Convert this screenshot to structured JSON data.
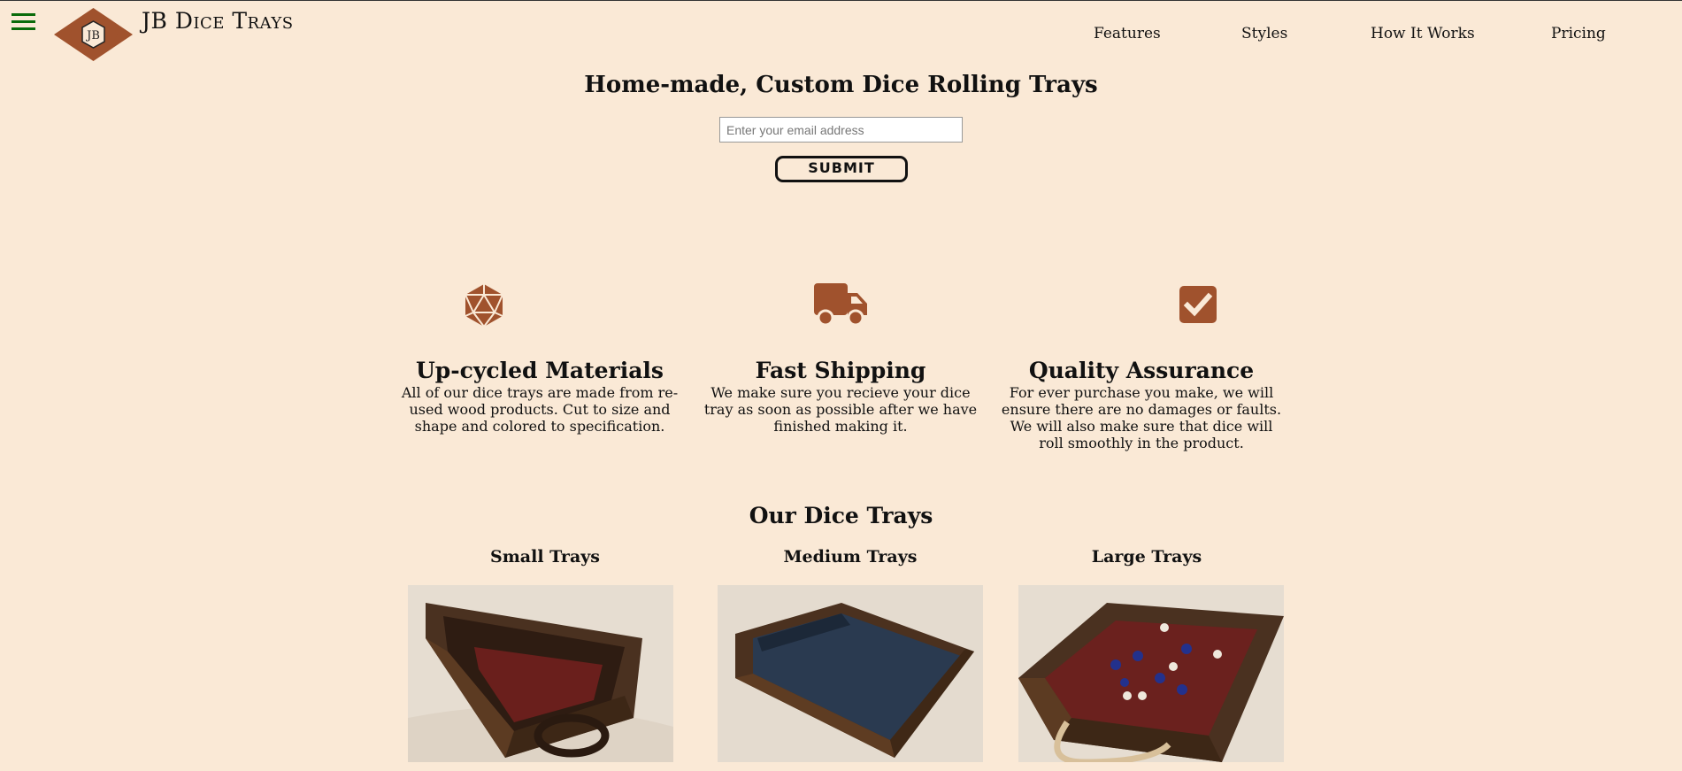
{
  "header": {
    "brand": "JB Dice Trays",
    "logo_letters": "JB",
    "nav": [
      "Features",
      "Styles",
      "How It Works",
      "Pricing"
    ]
  },
  "hero": {
    "title": "Home-made, Custom Dice Rolling Trays",
    "email_placeholder": "Enter your email address",
    "submit_label": "SUBMIT"
  },
  "features": [
    {
      "icon": "d20-dice-icon",
      "title": "Up-cycled Materials",
      "text": "All of our dice trays are made from re-used wood products. Cut to size and shape and colored to specification."
    },
    {
      "icon": "truck-icon",
      "title": "Fast Shipping",
      "text": "We make sure you recieve your dice tray as soon as possible after we have finished making it."
    },
    {
      "icon": "checkbox-icon",
      "title": "Quality Assurance",
      "text": "For ever purchase you make, we will ensure there are no damages or faults. We will also make sure that dice will roll smoothly in the product."
    }
  ],
  "trays": {
    "title": "Our Dice Trays",
    "items": [
      {
        "label": "Small Trays"
      },
      {
        "label": "Medium Trays"
      },
      {
        "label": "Large Trays"
      }
    ]
  },
  "colors": {
    "background": "#fae9d6",
    "accent": "#a0522d",
    "menu": "#0a6b0a"
  }
}
